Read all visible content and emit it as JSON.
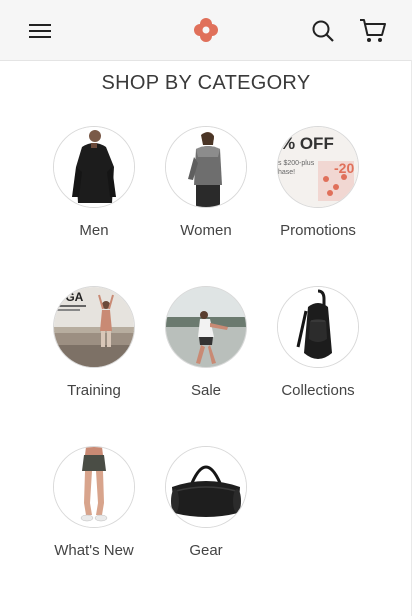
{
  "header": {
    "menu_icon": "hamburger-menu-icon",
    "logo_icon": "flower-logo-icon",
    "search_icon": "search-icon",
    "cart_icon": "shopping-cart-icon",
    "brand_color": "#e0705a"
  },
  "section": {
    "title": "SHOP BY CATEGORY"
  },
  "categories": [
    {
      "label": "Men",
      "image": "man-in-black-jacket"
    },
    {
      "label": "Women",
      "image": "woman-in-grey-top"
    },
    {
      "label": "Promotions",
      "image": "promo-banner",
      "promo_text": "% OFF",
      "promo_sub": "s $200-plus",
      "promo_sub2": "hase!",
      "promo_pct": "-20"
    },
    {
      "label": "Training",
      "image": "yoga-poster-woman",
      "poster_text": "OGA"
    },
    {
      "label": "Sale",
      "image": "runner-stretching"
    },
    {
      "label": "Collections",
      "image": "black-sling-backpack"
    },
    {
      "label": "What's New",
      "image": "woman-in-shorts"
    },
    {
      "label": "Gear",
      "image": "black-duffel-bag"
    }
  ]
}
